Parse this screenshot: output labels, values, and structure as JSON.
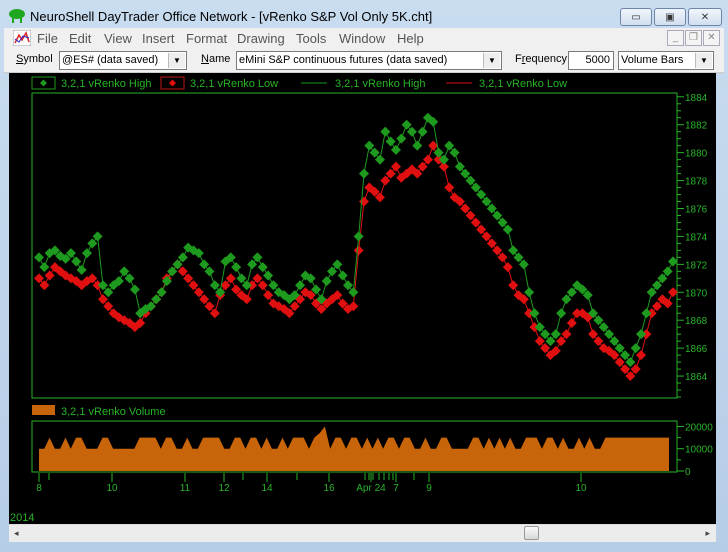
{
  "window": {
    "title": "NeuroShell DayTrader Office Network - [vRenko S&P Vol Only 5K.cht]",
    "minimize_label": "▭",
    "maximize_label": "▣",
    "close_label": "✕"
  },
  "menu": {
    "items": [
      "File",
      "Edit",
      "View",
      "Insert",
      "Format",
      "Drawing",
      "Tools",
      "Window",
      "Help"
    ],
    "mdi_minimize": "_",
    "mdi_restore": "❐",
    "mdi_close": "✕"
  },
  "toolbar": {
    "symbol_label_u": "S",
    "symbol_label_rest": "ymbol",
    "symbol_value": "@ES# (data saved)",
    "name_label_u": "N",
    "name_label_rest": "ame",
    "name_value": "eMini S&P continuous futures (data saved)",
    "frequency_label_pre": "F",
    "frequency_label_u": "r",
    "frequency_label_rest": "equency",
    "frequency_value": "5000",
    "bar_type_value": "Volume Bars",
    "dropdown_arrow": "▼"
  },
  "colors": {
    "high": "#1e9a1e",
    "low": "#e01010",
    "axis": "#28b428",
    "volume": "#c8640a",
    "background": "#000000"
  },
  "footer": {
    "year_label": "2014"
  },
  "scrollbar": {
    "left_arrow": "◂",
    "right_arrow": "▸",
    "position": 0.74
  },
  "chart_data": [
    {
      "type": "line",
      "title": "",
      "legend": [
        "3,2,1 vRenko High",
        "3,2,1 vRenko Low",
        "3,2,1 vRenko High",
        "3,2,1 vRenko Low"
      ],
      "legend_position": "top-left",
      "ylabel": "",
      "ylim": [
        1862.5,
        1884.2
      ],
      "yticks": [
        1864,
        1866,
        1868,
        1870,
        1872,
        1874,
        1876,
        1878,
        1880,
        1882,
        1884
      ],
      "grid": false,
      "series": [
        {
          "name": "3,2,1 vRenko High",
          "marker": "diamond",
          "values": [
            1872.5,
            1871.8,
            1872.8,
            1873.0,
            1872.6,
            1872.4,
            1872.8,
            1872.2,
            1871.6,
            1872.8,
            1873.5,
            1874.0,
            1870.5,
            1870.0,
            1870.5,
            1870.8,
            1871.5,
            1871.0,
            1870.2,
            1868.5,
            1868.8,
            1869.0,
            1869.5,
            1870.0,
            1870.8,
            1871.5,
            1872.0,
            1872.5,
            1873.2,
            1873.0,
            1872.8,
            1872.0,
            1871.5,
            1870.5,
            1870.0,
            1872.2,
            1872.5,
            1871.8,
            1871.0,
            1870.5,
            1872.0,
            1872.5,
            1871.8,
            1871.2,
            1870.5,
            1870.0,
            1869.8,
            1869.5,
            1869.8,
            1870.5,
            1871.2,
            1871.0,
            1870.2,
            1869.5,
            1870.8,
            1871.5,
            1872.0,
            1871.2,
            1870.5,
            1870.0,
            1874.0,
            1878.5,
            1880.5,
            1880.0,
            1879.5,
            1881.5,
            1880.8,
            1880.2,
            1881.0,
            1882.0,
            1881.5,
            1880.5,
            1881.5,
            1882.5,
            1882.2,
            1880.0,
            1879.5,
            1880.5,
            1880.0,
            1879.0,
            1878.5,
            1878.0,
            1877.5,
            1877.0,
            1876.5,
            1876.0,
            1875.5,
            1875.0,
            1874.5,
            1873.0,
            1872.5,
            1872.0,
            1870.0,
            1868.5,
            1867.5,
            1867.0,
            1866.5,
            1867.0,
            1868.5,
            1869.5,
            1870.0,
            1870.5,
            1870.2,
            1869.8,
            1868.5,
            1868.0,
            1867.5,
            1867.0,
            1866.5,
            1866.0,
            1865.5,
            1865.0,
            1866.0,
            1867.0,
            1868.5,
            1870.0,
            1870.5,
            1871.0,
            1871.5,
            1872.2
          ]
        },
        {
          "name": "3,2,1 vRenko Low",
          "marker": "diamond",
          "values": [
            1871.0,
            1870.5,
            1871.2,
            1871.8,
            1871.5,
            1871.2,
            1871.0,
            1870.8,
            1870.5,
            1870.8,
            1871.0,
            1870.5,
            1869.5,
            1869.0,
            1868.5,
            1868.2,
            1868.0,
            1867.8,
            1867.5,
            1867.8,
            1868.5,
            1869.0,
            1869.5,
            1870.0,
            1871.0,
            1871.5,
            1872.0,
            1871.5,
            1871.0,
            1870.5,
            1870.0,
            1869.5,
            1869.0,
            1868.5,
            1869.8,
            1870.5,
            1871.0,
            1870.2,
            1869.8,
            1869.5,
            1870.5,
            1871.0,
            1870.5,
            1869.8,
            1869.2,
            1869.0,
            1868.8,
            1868.5,
            1869.0,
            1869.5,
            1870.0,
            1869.8,
            1869.2,
            1868.8,
            1869.2,
            1869.5,
            1869.8,
            1869.2,
            1868.8,
            1869.0,
            1873.0,
            1876.5,
            1877.5,
            1877.2,
            1876.8,
            1878.0,
            1878.5,
            1879.0,
            1878.2,
            1878.5,
            1878.8,
            1878.5,
            1879.0,
            1879.5,
            1880.5,
            1879.5,
            1879.0,
            1877.5,
            1876.8,
            1876.5,
            1876.0,
            1875.5,
            1875.0,
            1874.5,
            1874.0,
            1873.5,
            1873.0,
            1872.5,
            1871.8,
            1870.5,
            1869.8,
            1869.5,
            1868.5,
            1867.5,
            1866.5,
            1866.0,
            1865.5,
            1865.8,
            1866.5,
            1867.0,
            1867.8,
            1868.5,
            1868.5,
            1868.2,
            1867.0,
            1866.5,
            1866.0,
            1865.8,
            1865.5,
            1865.0,
            1864.5,
            1864.0,
            1864.5,
            1865.5,
            1867.0,
            1868.5,
            1869.0,
            1869.5,
            1869.2,
            1870.0
          ]
        }
      ]
    },
    {
      "type": "area",
      "title": "",
      "legend": [
        "3,2,1 vRenko Volume"
      ],
      "legend_position": "top-left",
      "ylim": [
        0,
        22000
      ],
      "yticks": [
        0,
        10000,
        20000
      ],
      "xtick_labels": [
        "8",
        "10",
        "11",
        "12",
        "14",
        "16",
        "Apr 24",
        "7",
        "9",
        "10"
      ],
      "series": [
        {
          "name": "3,2,1 vRenko Volume",
          "values": [
            10000,
            10000,
            15000,
            10000,
            10000,
            15000,
            10000,
            15000,
            15000,
            10000,
            10000,
            10000,
            15000,
            15000,
            10000,
            10000,
            10000,
            10000,
            10000,
            15000,
            15000,
            15000,
            15000,
            10000,
            15000,
            15000,
            10000,
            10000,
            15000,
            10000,
            10000,
            15000,
            15000,
            15000,
            15000,
            10000,
            10000,
            15000,
            15000,
            10000,
            15000,
            15000,
            10000,
            15000,
            10000,
            10000,
            15000,
            10000,
            15000,
            15000,
            15000,
            10000,
            15000,
            17000,
            20000,
            10000,
            15000,
            15000,
            10000,
            15000,
            15000,
            10000,
            15000,
            10000,
            15000,
            10000,
            15000,
            15000,
            10000,
            15000,
            15000,
            10000,
            10000,
            15000,
            10000,
            10000,
            15000,
            15000,
            10000,
            10000,
            10000,
            10000,
            15000,
            15000,
            10000,
            15000,
            10000,
            15000,
            10000,
            15000,
            10000,
            10000,
            15000,
            15000,
            15000,
            10000,
            15000,
            15000,
            10000,
            15000,
            10000,
            10000,
            15000,
            10000,
            15000,
            10000,
            10000,
            15000,
            15000,
            15000,
            15000,
            15000,
            15000,
            15000,
            15000,
            15000,
            15000,
            15000,
            15000,
            15000
          ]
        }
      ]
    }
  ]
}
